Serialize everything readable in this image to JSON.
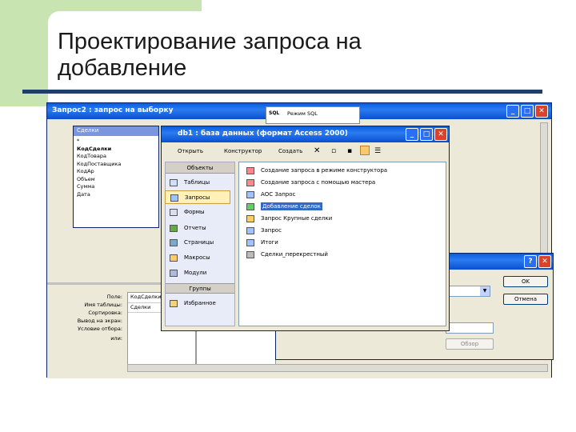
{
  "slide": {
    "title_line1": "Проектирование запроса на",
    "title_line2": "добавление"
  },
  "query_window": {
    "title": "Запрос2 : запрос на выборку",
    "table_name": "Сделки",
    "fields": [
      "*",
      "КодСделки",
      "КодТовара",
      "КодПоставщика",
      "КодАр",
      "Объем",
      "Сумма",
      "Дата"
    ],
    "grid_labels": [
      "Поле:",
      "Имя таблицы:",
      "Сортировка:",
      "Вывод на экран:",
      "Условие отбора:",
      "или:"
    ],
    "grid_field": "КодСделки",
    "grid_table": "Сделки"
  },
  "sql_menu": {
    "item": "Режим SQL"
  },
  "db_window": {
    "title": "db1 : база данных (формат Access 2000)",
    "toolbar": {
      "open": "Открыть",
      "design": "Конструктор",
      "create": "Создать"
    },
    "objects_header": "Объекты",
    "objects": [
      "Таблицы",
      "Запросы",
      "Формы",
      "Отчеты",
      "Страницы",
      "Макросы",
      "Модули"
    ],
    "selected_object": "Запросы",
    "groups_header": "Группы",
    "groups": [
      "Избранное"
    ],
    "queries": [
      "Создание запроса в режиме конструктора",
      "Создание запроса с помощью мастера",
      "АОС Запрос",
      "Добавление сделок",
      "Запрос Крупные сделки",
      "Запрос",
      "Итоги",
      "Сделки_перекрестный"
    ],
    "selected_query": "Добавление сделок"
  },
  "dialog": {
    "ok": "OK",
    "cancel": "Отмена",
    "browse": "Обзор"
  }
}
